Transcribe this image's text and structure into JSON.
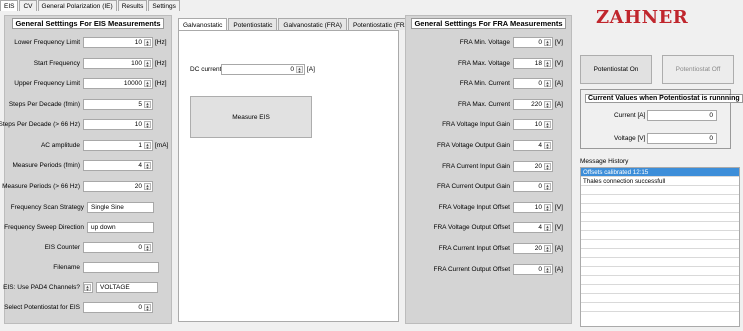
{
  "top_tabs": [
    "EIS",
    "CV",
    "General Polarization (IE)",
    "Results",
    "Settings"
  ],
  "eis": {
    "title": "General Setttings For EIS Measurements",
    "rows": [
      {
        "label": "Lower Frequency Limit",
        "value": "10",
        "unit": "[Hz]"
      },
      {
        "label": "Start Frequency",
        "value": "100",
        "unit": "[Hz]"
      },
      {
        "label": "Upper Frequency Limit",
        "value": "10000",
        "unit": "[Hz]"
      },
      {
        "label": "Steps Per Decade (fmin)",
        "value": "5",
        "unit": ""
      },
      {
        "label": "Steps Per Decade (> 66 Hz)",
        "value": "10",
        "unit": ""
      },
      {
        "label": "AC amplitude",
        "value": "1",
        "unit": "[mA]"
      },
      {
        "label": "Measure Periods (fmin)",
        "value": "4",
        "unit": ""
      },
      {
        "label": "Measure Periods (> 66 Hz)",
        "value": "20",
        "unit": ""
      }
    ],
    "scan_strategy_label": "Frequency Scan Strategy",
    "scan_strategy_value": "Single Sine",
    "sweep_direction_label": "Frequency Sweep Direction",
    "sweep_direction_value": "up down",
    "counter_label": "EIS Counter",
    "counter_value": "0",
    "filename_label": "Filename",
    "filename_value": "",
    "pad4_label": "EIS: Use PAD4 Channels?",
    "pad4_value": "VOLTAGE",
    "potentiostat_label": "Select Potentiostat for EIS",
    "potentiostat_value": "0"
  },
  "mid_tabs": [
    "Galvanostatic",
    "Potentiostatic",
    "Galvanostatic (FRA)",
    "Potentiostatic (FRA)"
  ],
  "galvanostatic": {
    "dc_label": "DC current",
    "dc_value": "0",
    "dc_unit": "[A]",
    "measure_button": "Measure EIS"
  },
  "fra": {
    "title": "General Setttings For FRA Measurements",
    "rows": [
      {
        "label": "FRA Min. Voltage",
        "value": "0",
        "unit": "[V]"
      },
      {
        "label": "FRA Max. Voltage",
        "value": "18",
        "unit": "[V]"
      },
      {
        "label": "FRA Min. Current",
        "value": "0",
        "unit": "[A]"
      },
      {
        "label": "FRA Max. Current",
        "value": "220",
        "unit": "[A]"
      },
      {
        "label": "FRA Voltage Input Gain",
        "value": "10",
        "unit": ""
      },
      {
        "label": "FRA Voltage Output Gain",
        "value": "4",
        "unit": ""
      },
      {
        "label": "FRA Current Input Gain",
        "value": "20",
        "unit": ""
      },
      {
        "label": "FRA Current Output Gain",
        "value": "0",
        "unit": ""
      },
      {
        "label": "FRA Voltage Input Offset",
        "value": "10",
        "unit": "[V]"
      },
      {
        "label": "FRA Voltage Output Offset",
        "value": "4",
        "unit": "[V]"
      },
      {
        "label": "FRA Current Input Offset",
        "value": "20",
        "unit": "[A]"
      },
      {
        "label": "FRA Current Output Offset",
        "value": "0",
        "unit": "[A]"
      }
    ]
  },
  "right": {
    "logo": "ZAHNER",
    "pot_on": "Potentiostat On",
    "pot_off": "Potentiostat Off",
    "current_values_title": "Current Values when Potentiostat is runnning",
    "current_label": "Current [A]",
    "current_value": "0",
    "voltage_label": "Voltage [V]",
    "voltage_value": "0",
    "message_history_label": "Message History",
    "messages": [
      "Offsets calibrated  12:15",
      "Thales connection successfull"
    ]
  },
  "colors": {
    "logo": "#c0262d",
    "selection": "#3d8ed9",
    "panel_bg": "#d4d4d4"
  }
}
